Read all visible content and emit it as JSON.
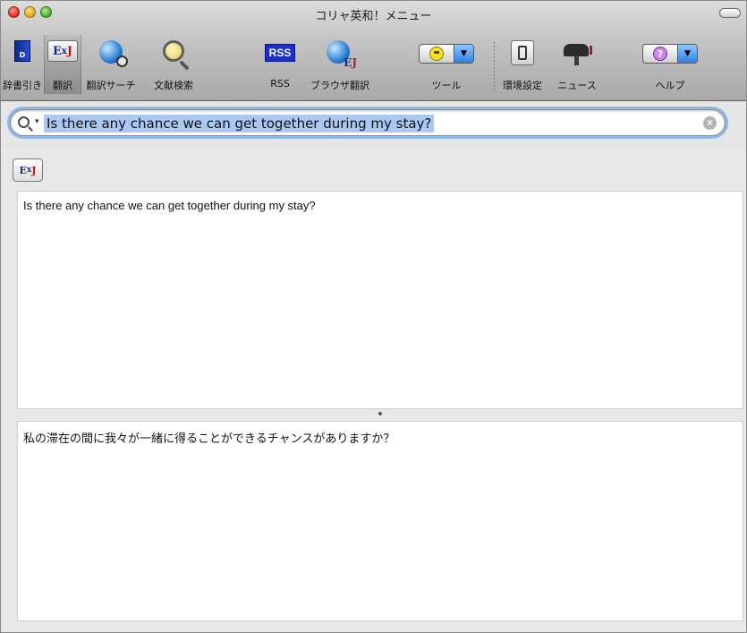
{
  "window": {
    "title": "コリャ英和！メニュー"
  },
  "toolbar": {
    "items": [
      {
        "label": "辞書引き",
        "icon": "dictionary-book-icon"
      },
      {
        "label": "翻訳",
        "icon": "ej-translate-icon",
        "selected": true
      },
      {
        "label": "翻訳サーチ",
        "icon": "globe-search-icon"
      },
      {
        "label": "文献検索",
        "icon": "magnifier-icon"
      },
      {
        "label": "RSS",
        "icon": "rss-icon",
        "icon_text": "RSS"
      },
      {
        "label": "ブラウザ翻訳",
        "icon": "globe-ej-icon"
      },
      {
        "label": "ツール",
        "icon": "smiley-popup-icon"
      },
      {
        "label": "環境設定",
        "icon": "switch-icon"
      },
      {
        "label": "ニュース",
        "icon": "mailbox-icon"
      },
      {
        "label": "ヘルプ",
        "icon": "help-popup-icon"
      }
    ]
  },
  "search": {
    "value": "Is there any chance we can get together during my stay?"
  },
  "translation": {
    "direction_button": {
      "e": "E",
      "x": "x",
      "j": "J"
    },
    "source_text": "Is there any chance we can get together during my stay?",
    "result_text": "私の滞在の間に我々が一緒に得ることができるチャンスがありますか？"
  },
  "colors": {
    "selection": "#a9c9f2",
    "focus_ring": "#8db8ea",
    "rss_blue": "#1a2fd0"
  }
}
